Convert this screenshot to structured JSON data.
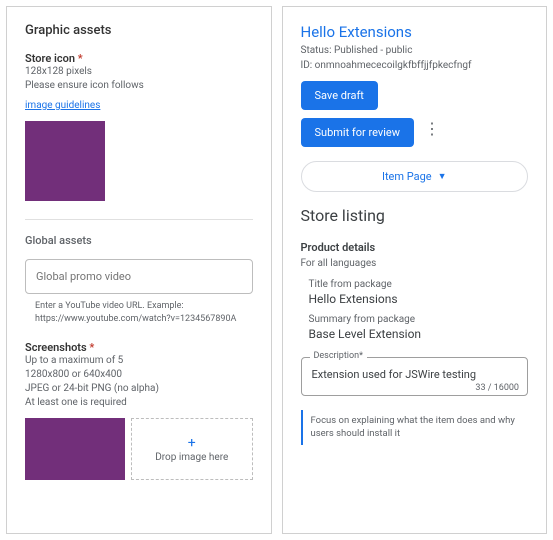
{
  "left": {
    "heading": "Graphic assets",
    "storeIcon": {
      "label": "Store icon",
      "dims": "128x128 pixels",
      "ensure": "Please ensure icon follows",
      "guidelinesLink": "image guidelines"
    },
    "globalAssetsLabel": "Global assets",
    "promo": {
      "placeholder": "Global promo video",
      "help": "Enter a YouTube video URL. Example: https://www.youtube.com/watch?v=1234567890A"
    },
    "screenshots": {
      "label": "Screenshots",
      "l1": "Up to a maximum of 5",
      "l2": "1280x800 or 640x400",
      "l3": "JPEG or 24-bit PNG (no alpha)",
      "l4": "At least one is required",
      "drop": "Drop image here"
    }
  },
  "right": {
    "title": "Hello Extensions",
    "status": "Status: Published - public",
    "id": "ID: onmnoahmececoilgkfbffjjfpkecfngf",
    "saveDraft": "Save draft",
    "submit": "Submit for review",
    "itemPage": "Item Page",
    "storeListing": "Store listing",
    "productDetails": "Product details",
    "allLanguages": "For all languages",
    "titleFromPkgLabel": "Title from package",
    "titleFromPkgValue": "Hello Extensions",
    "summaryLabel": "Summary from package",
    "summaryValue": "Base Level Extension",
    "descriptionLabel": "Description*",
    "descriptionValue": "Extension used for JSWire testing",
    "counter": "33 / 16000",
    "focusNote": "Focus on explaining what the item does and why users should install it"
  }
}
